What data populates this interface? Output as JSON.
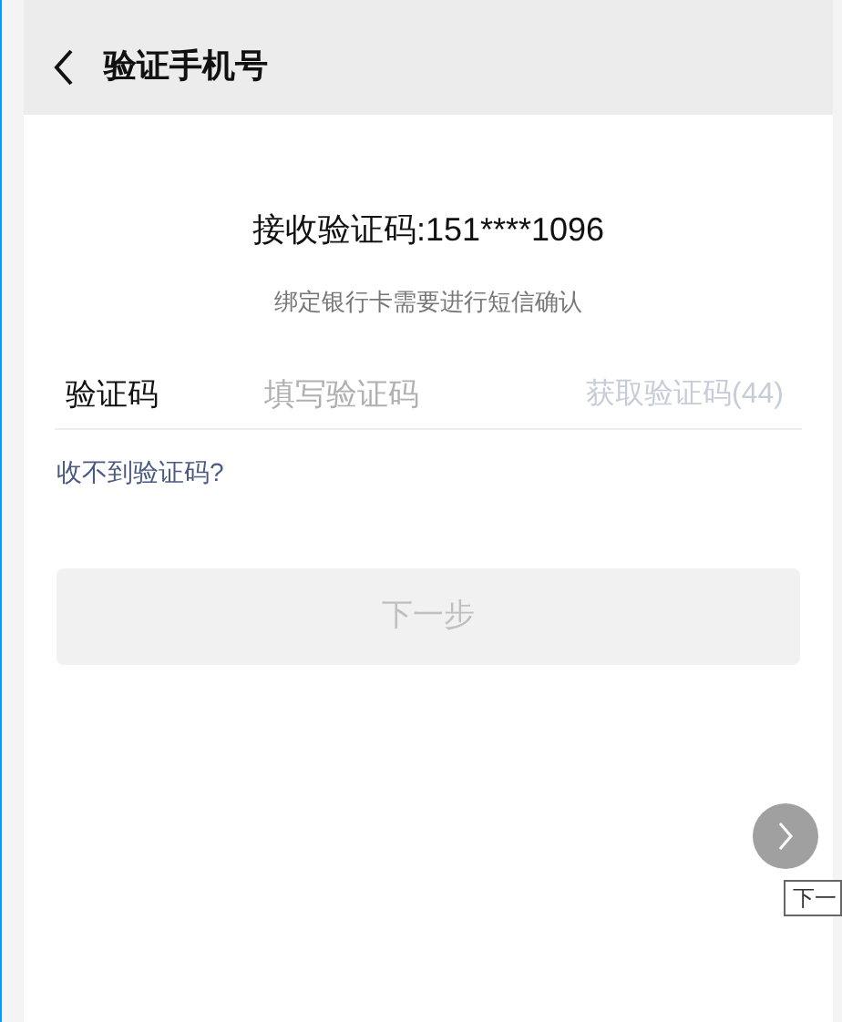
{
  "header": {
    "title": "验证手机号"
  },
  "receive_label": "接收验证码:151****1096",
  "subtitle": "绑定银行卡需要进行短信确认",
  "code_field": {
    "label": "验证码",
    "placeholder": "填写验证码",
    "get_code": "获取验证码(44)",
    "get_code_disabled": true
  },
  "help_link": "收不到验证码?",
  "next_button": {
    "label": "下一步",
    "disabled": true
  },
  "overlay_tooltip": "下一"
}
